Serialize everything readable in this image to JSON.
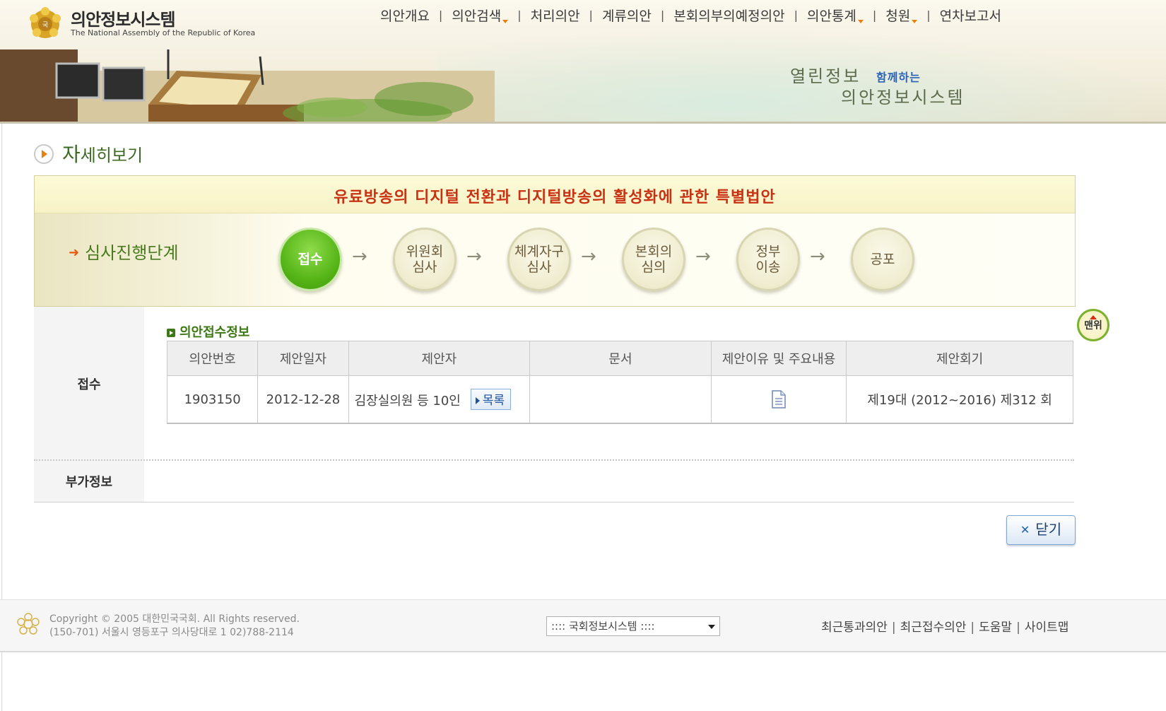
{
  "header": {
    "site_title": "의안정보시스템",
    "site_subtitle": "The National Assembly of the Republic of Korea",
    "nav": [
      {
        "label": "의안개요",
        "dropdown": false
      },
      {
        "label": "의안검색",
        "dropdown": true
      },
      {
        "label": "처리의안",
        "dropdown": false
      },
      {
        "label": "계류의안",
        "dropdown": false
      },
      {
        "label": "본회의부의예정의안",
        "dropdown": false
      },
      {
        "label": "의안통계",
        "dropdown": true
      },
      {
        "label": "청원",
        "dropdown": true
      },
      {
        "label": "연차보고서",
        "dropdown": false
      }
    ],
    "slogan_line1": "열린정보",
    "slogan_small": "함께하는",
    "slogan_line2": "의안정보시스템"
  },
  "page": {
    "title_big": "자",
    "title_rest": "세히보기"
  },
  "bill": {
    "title": "유료방송의 디지털 전환과 디지털방송의 활성화에 관한 특별법안",
    "stage_label": "심사진행단계",
    "steps": [
      {
        "line1": "접수",
        "line2": "",
        "active": true
      },
      {
        "line1": "위원회",
        "line2": "심사",
        "active": false
      },
      {
        "line1": "체계자구",
        "line2": "심사",
        "active": false
      },
      {
        "line1": "본회의",
        "line2": "심의",
        "active": false
      },
      {
        "line1": "정부",
        "line2": "이송",
        "active": false
      },
      {
        "line1": "공포",
        "line2": "",
        "active": false
      }
    ],
    "step_arrow": "→"
  },
  "receipt": {
    "side_label": "접수",
    "section_title": "의안접수정보",
    "columns": [
      "의안번호",
      "제안일자",
      "제안자",
      "문서",
      "제안이유 및 주요내용",
      "제안회기"
    ],
    "row": {
      "bill_no": "1903150",
      "date": "2012-12-28",
      "proposer": "김장실의원 등 10인",
      "list_btn": "목록",
      "session": "제19대 (2012~2016) 제312 회"
    }
  },
  "extra": {
    "side_label": "부가정보"
  },
  "buttons": {
    "top": "맨위",
    "close": "닫기"
  },
  "footer": {
    "copyright_line1": "Copyright © 2005 대한민국국회. All Rights reserved.",
    "copyright_line2": "(150-701) 서울시 영등포구 의사당대로 1  02)788-2114",
    "select_value": ":::: 국회정보시스템 ::::",
    "links": [
      "최근통과의안",
      "최근접수의안",
      "도움말",
      "사이트맵"
    ]
  },
  "colors": {
    "accent_green": "#3d7a16",
    "bill_title_red": "#c83212",
    "active_step_green": "#56b517"
  }
}
